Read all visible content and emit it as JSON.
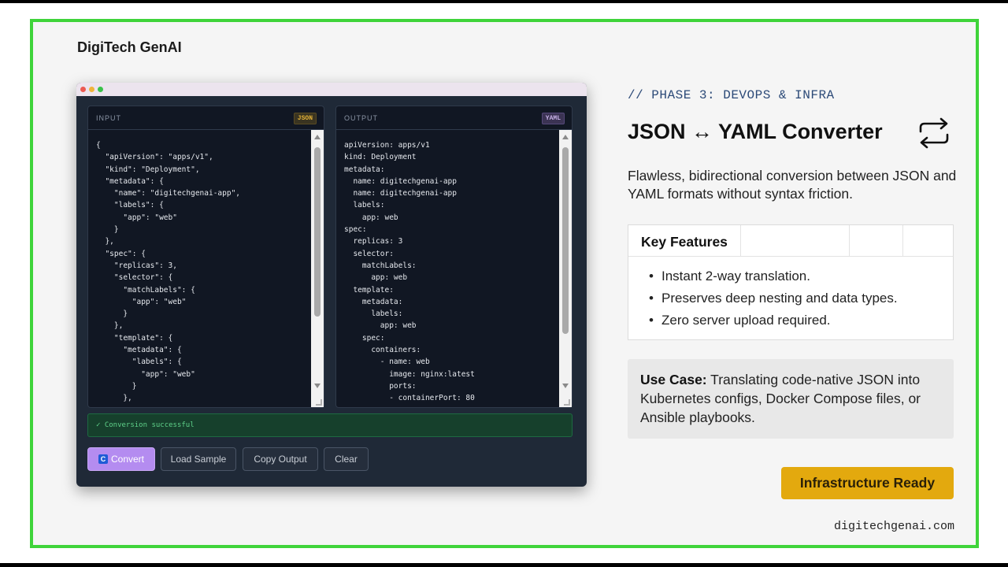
{
  "brand": "DigiTech GenAI",
  "app": {
    "input_pane": {
      "label": "INPUT",
      "badge": "JSON",
      "code": "{\n  \"apiVersion\": \"apps/v1\",\n  \"kind\": \"Deployment\",\n  \"metadata\": {\n    \"name\": \"digitechgenai-app\",\n    \"labels\": {\n      \"app\": \"web\"\n    }\n  },\n  \"spec\": {\n    \"replicas\": 3,\n    \"selector\": {\n      \"matchLabels\": {\n        \"app\": \"web\"\n      }\n    },\n    \"template\": {\n      \"metadata\": {\n        \"labels\": {\n          \"app\": \"web\"\n        }\n      },\n      \"spec\": {\n        \"containers\": [{\n          \"name\": \"web\",\n          \"image\": \"nginx:latest\",\n          \"ports\": [{\"containerPort\": 80}]"
    },
    "output_pane": {
      "label": "OUTPUT",
      "badge": "YAML",
      "code": "apiVersion: apps/v1\nkind: Deployment\nmetadata:\n  name: digitechgenai-app\n  name: digitechgenai-app\n  labels:\n    app: web\nspec:\n  replicas: 3\n  selector:\n    matchLabels:\n      app: web\n  template:\n    metadata:\n      labels:\n        app: web\n    spec:\n      containers:\n        - name: web\n          image: nginx:latest\n          ports:\n          - containerPort: 80"
    },
    "status": "✓ Conversion successful",
    "buttons": {
      "convert": "Convert",
      "load_sample": "Load Sample",
      "copy_output": "Copy Output",
      "clear": "Clear"
    }
  },
  "info": {
    "phase": "// PHASE 3: DEVOPS & INFRA",
    "title": "JSON ↔ YAML Converter",
    "description": "Flawless, bidirectional conversion between JSON and YAML formats without syntax friction.",
    "features_heading": "Key Features",
    "features": [
      "Instant 2-way translation.",
      "Preserves deep nesting and data types.",
      "Zero server upload required."
    ],
    "use_case_label": "Use Case:",
    "use_case_text": " Translating code-native JSON into Kubernetes configs, Docker Compose files, or Ansible playbooks.",
    "ready_badge": "Infrastructure Ready",
    "website": "digitechgenai.com"
  },
  "icons": {
    "swap": "arrows-swap-icon",
    "convert": "convert-icon",
    "check": "check-icon"
  },
  "colors": {
    "frame_border": "#3fd43a",
    "accent_purple": "#b48cf0",
    "ready_badge": "#e3a90e",
    "success": "#5fd28a"
  }
}
